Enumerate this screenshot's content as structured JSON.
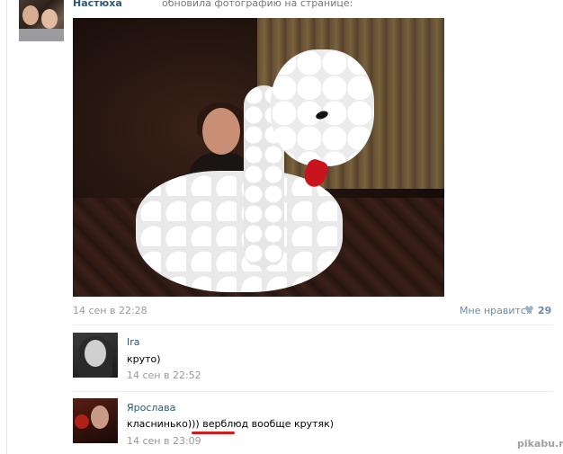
{
  "post": {
    "author": "Настюха",
    "action": "обновила фотографию на странице:",
    "date": "14 сен в 22:28",
    "like_label": "Мне нравится",
    "like_count": "29",
    "like_icon": "heart-icon"
  },
  "comments": [
    {
      "name": "Ira",
      "text": "круто)",
      "date": "14 сен в 22:52"
    },
    {
      "name": "Ярослава",
      "text": "класнинько))) верблюд вообще крутяк)",
      "date": "14 сен в 23:09"
    }
  ],
  "watermark": "pikabu.ru",
  "colors": {
    "link": "#2b587a",
    "muted": "#999999",
    "highlight_underline": "#d41919"
  }
}
